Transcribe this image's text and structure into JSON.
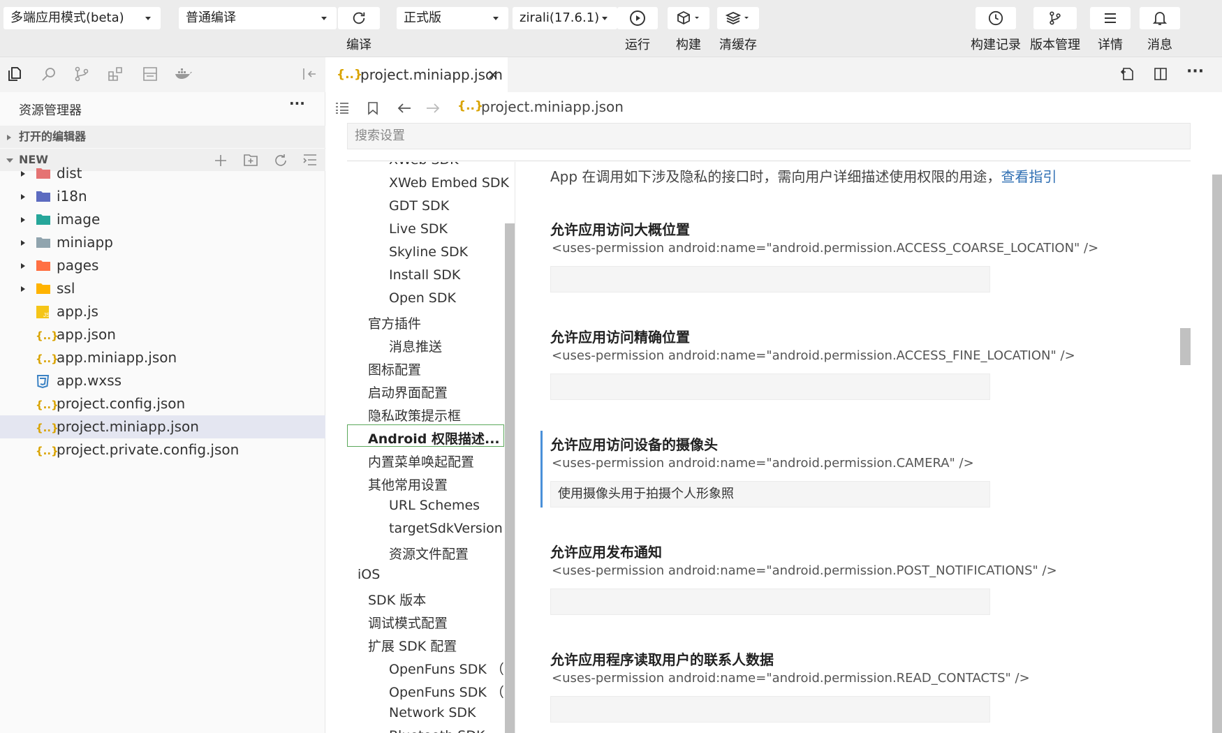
{
  "toolbar": {
    "mode_select": "多端应用模式(beta)",
    "compile_select": "普通编译",
    "compile_label": "编译",
    "version_select": "正式版",
    "base_lib_select": "zirali(17.6.1)",
    "run_label": "运行",
    "build_label": "构建",
    "clear_cache_label": "清缓存",
    "build_record_label": "构建记录",
    "version_mgmt_label": "版本管理",
    "details_label": "详情",
    "messages_label": "消息"
  },
  "sidebar": {
    "title": "资源管理器",
    "more": "···",
    "open_editors": "打开的编辑器",
    "project_name": "NEW",
    "tree": [
      {
        "name": "dist",
        "type": "folder",
        "color": "#e57373"
      },
      {
        "name": "i18n",
        "type": "folder",
        "color": "#5c6bc0"
      },
      {
        "name": "image",
        "type": "folder",
        "color": "#26a69a"
      },
      {
        "name": "miniapp",
        "type": "folder",
        "color": "#90a4ae"
      },
      {
        "name": "pages",
        "type": "folder",
        "color": "#ff7043"
      },
      {
        "name": "ssl",
        "type": "folder",
        "color": "#ffb300"
      },
      {
        "name": "app.js",
        "type": "js"
      },
      {
        "name": "app.json",
        "type": "json"
      },
      {
        "name": "app.miniapp.json",
        "type": "json"
      },
      {
        "name": "app.wxss",
        "type": "wxss"
      },
      {
        "name": "project.config.json",
        "type": "json"
      },
      {
        "name": "project.miniapp.json",
        "type": "json"
      },
      {
        "name": "project.private.config.json",
        "type": "json"
      }
    ]
  },
  "editor": {
    "tab_title": "project.miniapp.json",
    "breadcrumb_file": "project.miniapp.json",
    "search_placeholder": "搜索设置",
    "toc": [
      {
        "label": "XWeb SDK",
        "indent": 2
      },
      {
        "label": "XWeb Embed SDK",
        "indent": 2
      },
      {
        "label": "GDT SDK",
        "indent": 2
      },
      {
        "label": "Live SDK",
        "indent": 2
      },
      {
        "label": "Skyline SDK",
        "indent": 2
      },
      {
        "label": "Install SDK",
        "indent": 2
      },
      {
        "label": "Open SDK",
        "indent": 2
      },
      {
        "label": "官方插件",
        "indent": 1
      },
      {
        "label": "消息推送",
        "indent": 2
      },
      {
        "label": "图标配置",
        "indent": 1
      },
      {
        "label": "启动界面配置",
        "indent": 1
      },
      {
        "label": "隐私政策提示框",
        "indent": 1
      },
      {
        "label": "Android 权限描述...",
        "indent": 1,
        "selected": true
      },
      {
        "label": "内置菜单唤起配置",
        "indent": 1
      },
      {
        "label": "其他常用设置",
        "indent": 1
      },
      {
        "label": "URL Schemes",
        "indent": 2
      },
      {
        "label": "targetSdkVersion",
        "indent": 2
      },
      {
        "label": "资源文件配置",
        "indent": 2
      },
      {
        "label": "iOS",
        "indent": 0
      },
      {
        "label": "SDK 版本",
        "indent": 1
      },
      {
        "label": "调试模式配置",
        "indent": 1
      },
      {
        "label": "扩展 SDK 配置",
        "indent": 1
      },
      {
        "label": "OpenFuns SDK （...",
        "indent": 2
      },
      {
        "label": "OpenFuns SDK （...",
        "indent": 2
      },
      {
        "label": "Network SDK",
        "indent": 2
      },
      {
        "label": "Bluetooth SDK",
        "indent": 2
      }
    ],
    "description": "App 在调用如下涉及隐私的接口时，需向用户详细描述使用权限的用途，",
    "description_link": "查看指引",
    "permissions": [
      {
        "title": "允许应用访问大概位置",
        "code": "<uses-permission android:name=\"android.permission.ACCESS_COARSE_LOCATION\" />",
        "value": ""
      },
      {
        "title": "允许应用访问精确位置",
        "code": "<uses-permission android:name=\"android.permission.ACCESS_FINE_LOCATION\" />",
        "value": ""
      },
      {
        "title": "允许应用访问设备的摄像头",
        "code": "<uses-permission android:name=\"android.permission.CAMERA\" />",
        "value": "使用摄像头用于拍摄个人形象照"
      },
      {
        "title": "允许应用发布通知",
        "code": "<uses-permission android:name=\"android.permission.POST_NOTIFICATIONS\" />",
        "value": ""
      },
      {
        "title": "允许应用程序读取用户的联系人数据",
        "code": "<uses-permission android:name=\"android.permission.READ_CONTACTS\" />",
        "value": ""
      }
    ]
  }
}
